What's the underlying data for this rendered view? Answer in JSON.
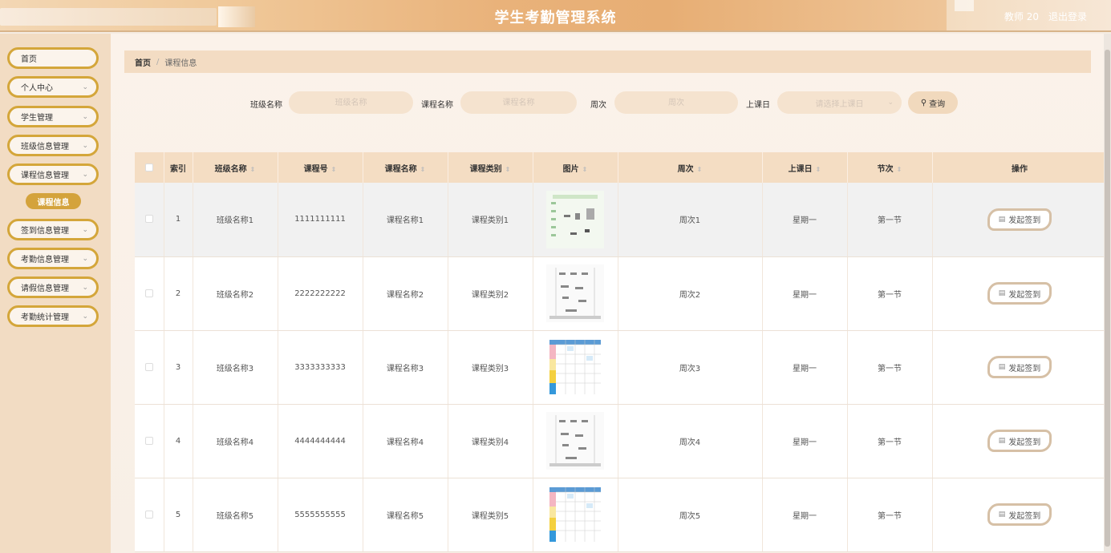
{
  "app": {
    "title": "学生考勤管理系统"
  },
  "user": {
    "name": "教师 20",
    "logout": "退出登录"
  },
  "sidebar": {
    "items": [
      {
        "label": "首页",
        "has_chevron": false
      },
      {
        "label": "个人中心",
        "has_chevron": true
      },
      {
        "label": "学生管理",
        "has_chevron": true
      },
      {
        "label": "班级信息管理",
        "has_chevron": true
      },
      {
        "label": "课程信息管理",
        "has_chevron": true
      },
      {
        "label": "签到信息管理",
        "has_chevron": true
      },
      {
        "label": "考勤信息管理",
        "has_chevron": true
      },
      {
        "label": "请假信息管理",
        "has_chevron": true
      },
      {
        "label": "考勤统计管理",
        "has_chevron": true
      }
    ],
    "active_sub": "课程信息"
  },
  "breadcrumb": {
    "home": "首页",
    "sep": "/",
    "current": "课程信息"
  },
  "filters": {
    "class_label": "班级名称",
    "class_placeholder": "班级名称",
    "course_label": "课程名称",
    "course_placeholder": "课程名称",
    "week_label": "周次",
    "week_placeholder": "周次",
    "day_label": "上课日",
    "day_placeholder": "请选择上课日",
    "search_label": "查询"
  },
  "table": {
    "headers": [
      "索引",
      "班级名称",
      "课程号",
      "课程名称",
      "课程类别",
      "图片",
      "周次",
      "上课日",
      "节次",
      "操作"
    ],
    "sortable": [
      false,
      true,
      true,
      true,
      true,
      true,
      true,
      true,
      true,
      false
    ],
    "rows": [
      {
        "idx": "1",
        "class": "班级名称1",
        "code": "1111111111",
        "course": "课程名称1",
        "type": "课程类别1",
        "img": "flowchart-green",
        "week": "周次1",
        "day": "星期一",
        "period": "第一节",
        "action": "发起签到"
      },
      {
        "idx": "2",
        "class": "班级名称2",
        "code": "2222222222",
        "course": "课程名称2",
        "type": "课程类别2",
        "img": "flowchart-gray",
        "week": "周次2",
        "day": "星期一",
        "period": "第一节",
        "action": "发起签到"
      },
      {
        "idx": "3",
        "class": "班级名称3",
        "code": "3333333333",
        "course": "课程名称3",
        "type": "课程类别3",
        "img": "timetable-color",
        "week": "周次3",
        "day": "星期一",
        "period": "第一节",
        "action": "发起签到"
      },
      {
        "idx": "4",
        "class": "班级名称4",
        "code": "4444444444",
        "course": "课程名称4",
        "type": "课程类别4",
        "img": "flowchart-gray",
        "week": "周次4",
        "day": "星期一",
        "period": "第一节",
        "action": "发起签到"
      },
      {
        "idx": "5",
        "class": "班级名称5",
        "code": "5555555555",
        "course": "课程名称5",
        "type": "课程类别5",
        "img": "timetable-color",
        "week": "周次5",
        "day": "星期一",
        "period": "第一节",
        "action": "发起签到"
      }
    ]
  },
  "colors": {
    "accent": "#d4a63a",
    "header_bg": "#e9b27a",
    "table_head": "#f4ddc3"
  }
}
